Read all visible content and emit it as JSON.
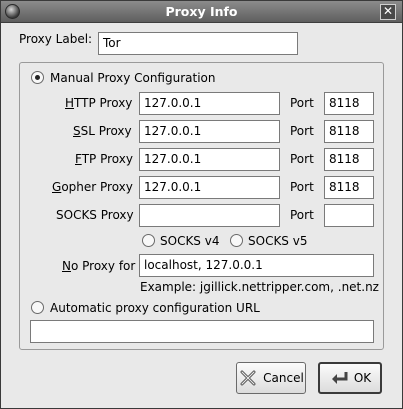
{
  "window": {
    "title": "Proxy Info"
  },
  "proxy_label": {
    "label": "Proxy Label:",
    "value": "Tor"
  },
  "manual": {
    "label": "Manual Proxy Configuration",
    "selected": true,
    "rows": [
      {
        "name": "http",
        "mnemonic": "H",
        "rest": "TTP Proxy",
        "host": "127.0.0.1",
        "port_label": "Port",
        "port": "8118"
      },
      {
        "name": "ssl",
        "mnemonic": "S",
        "rest": "SL Proxy",
        "host": "127.0.0.1",
        "port_label": "Port",
        "port": "8118"
      },
      {
        "name": "ftp",
        "mnemonic": "F",
        "rest": "TP Proxy",
        "host": "127.0.0.1",
        "port_label": "Port",
        "port": "8118"
      },
      {
        "name": "gopher",
        "mnemonic": "G",
        "rest": "opher Proxy",
        "host": "127.0.0.1",
        "port_label": "Port",
        "port": "8118"
      }
    ],
    "socks": {
      "label": "SOCKS Proxy",
      "host": "",
      "port_label": "Port",
      "port": "",
      "v4": "SOCKS v4",
      "v5": "SOCKS v5"
    },
    "no_proxy": {
      "mnemonic": "N",
      "rest": "o Proxy for",
      "value": "localhost, 127.0.0.1",
      "example": "Example: jgillick.nettripper.com, .net.nz"
    }
  },
  "auto": {
    "label": "Automatic proxy configuration URL",
    "value": "",
    "selected": false
  },
  "buttons": {
    "cancel": "Cancel",
    "ok": "OK"
  }
}
